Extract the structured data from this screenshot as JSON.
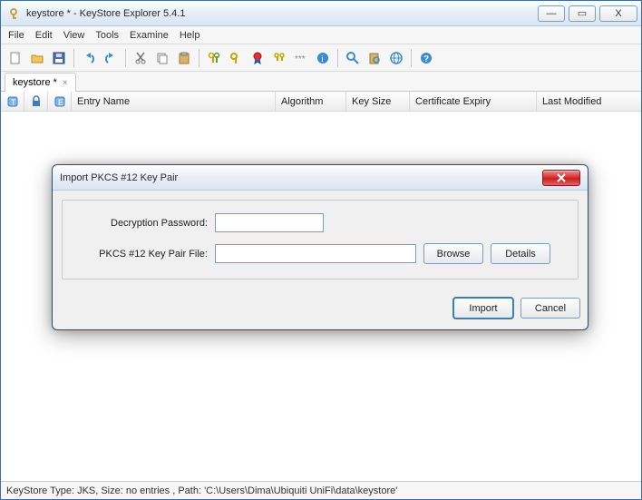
{
  "window": {
    "title": "keystore * - KeyStore Explorer 5.4.1",
    "controls": {
      "min": "—",
      "max": "▭",
      "close": "X"
    }
  },
  "menu": {
    "file": "File",
    "edit": "Edit",
    "view": "View",
    "tools": "Tools",
    "examine": "Examine",
    "help": "Help"
  },
  "tabs": {
    "active": {
      "label": "keystore *",
      "close_glyph": "×"
    }
  },
  "columns": {
    "icon_t": "T",
    "icon_lock": "🔒",
    "icon_e": "E",
    "entry_name": "Entry Name",
    "algorithm": "Algorithm",
    "key_size": "Key Size",
    "cert_expiry": "Certificate Expiry",
    "last_modified": "Last Modified"
  },
  "statusbar": {
    "text": "KeyStore Type: JKS, Size: no entries , Path: 'C:\\Users\\Dima\\Ubiquiti UniFi\\data\\keystore'"
  },
  "dialog": {
    "title": "Import PKCS #12 Key Pair",
    "password_label": "Decryption Password:",
    "password_value": "",
    "file_label": "PKCS #12 Key Pair File:",
    "file_value": "",
    "browse": "Browse",
    "details": "Details",
    "import": "Import",
    "cancel": "Cancel"
  },
  "toolbar_icons": {
    "new": "new-file-icon",
    "open": "open-folder-icon",
    "save": "save-disk-icon",
    "undo": "undo-icon",
    "redo": "redo-icon",
    "cut": "cut-icon",
    "copy": "copy-icon",
    "paste": "paste-icon",
    "genkeypair": "generate-keypair-icon",
    "genseckey": "generate-secretkey-icon",
    "import_cert": "import-cert-icon",
    "import_keypair": "import-keypair-icon",
    "setpassword": "set-password-icon",
    "properties": "properties-icon",
    "examine_file": "examine-file-icon",
    "examine_clip": "examine-clipboard-icon",
    "examine_ssl": "examine-ssl-icon",
    "help": "help-icon"
  }
}
